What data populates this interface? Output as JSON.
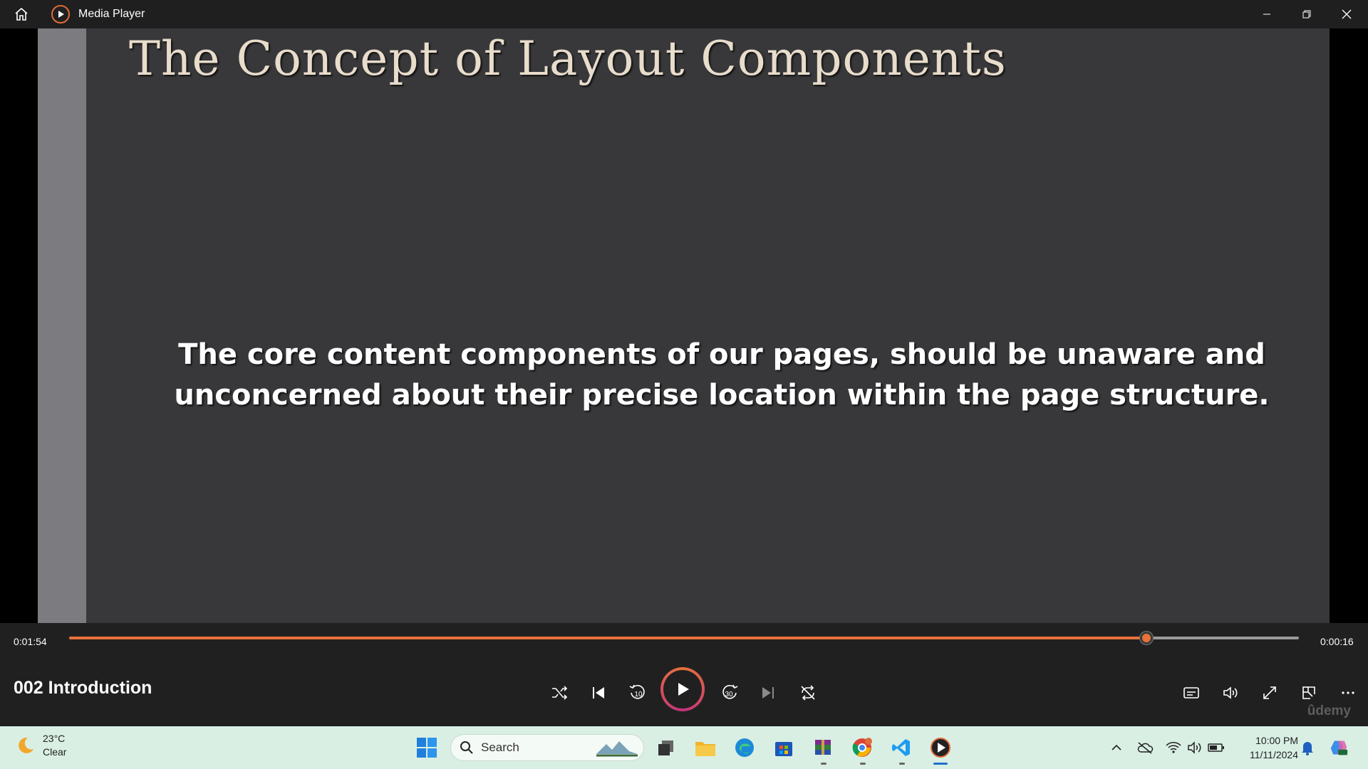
{
  "window": {
    "title": "Media Player"
  },
  "slide": {
    "title": "The Concept of Layout Components",
    "body_line1": "The core content components of our pages, should be unaware and",
    "body_line2": "unconcerned about their precise location within the page structure."
  },
  "playback": {
    "elapsed": "0:01:54",
    "remaining": "0:00:16",
    "progress_fraction": 0.876,
    "track_title": "002 Introduction",
    "skip_back_seconds": "10",
    "skip_forward_seconds": "30",
    "watermark": "ûdemy"
  },
  "taskbar": {
    "weather_temp": "23°C",
    "weather_desc": "Clear",
    "search_placeholder": "Search",
    "time": "10:00 PM",
    "date": "11/11/2024"
  },
  "colors": {
    "accent": "#e8723a",
    "slide_bg": "#38383b",
    "control_bg": "#202020",
    "taskbar_bg": "#d9efe4"
  }
}
